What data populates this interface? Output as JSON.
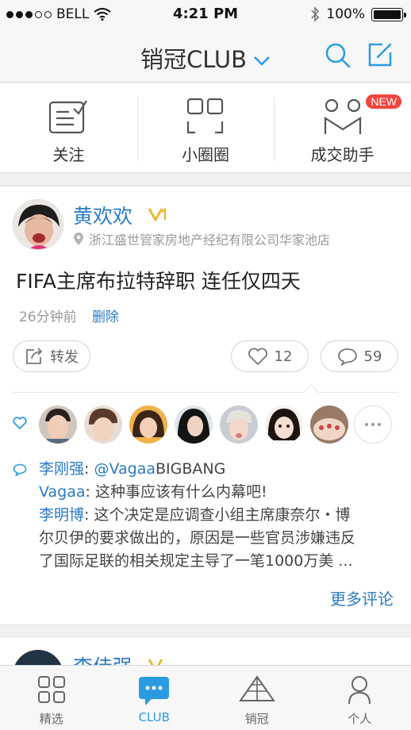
{
  "status_bar": {
    "carrier": "BELL",
    "time": "4:21 PM",
    "battery": "100%"
  },
  "nav": {
    "title": "销冠CLUB"
  },
  "quick_menu": [
    {
      "label": "关注"
    },
    {
      "label": "小圈圈"
    },
    {
      "label": "成交助手",
      "badge": "NEW"
    }
  ],
  "post": {
    "author": "黄欢欢",
    "verified_badge": "V",
    "location": "浙江盛世管家房地产经纪有限公司华家池店",
    "text": "FIFA主席布拉特辞职 连任仅四天",
    "time": "26分钟前",
    "delete_label": "删除",
    "forward_label": "转发",
    "like_count": "12",
    "comment_count": "59",
    "comments": [
      {
        "name": "李刚强",
        "sep": ": ",
        "mention": "@Vagaa",
        "text": "BIGBANG"
      },
      {
        "name": "Vagaa",
        "sep": ": ",
        "text": "这种事应该有什么内幕吧!"
      },
      {
        "name": "李明博",
        "sep": ": ",
        "text": "这个决定是应调查小组主席康奈尔・博"
      },
      {
        "text": "尔贝伊的要求做出的，原因是一些官员涉嫌违反"
      },
      {
        "text": "了国际足联的相关规定主导了一笔1000万美 ..."
      }
    ],
    "more_comments_label": "更多评论"
  },
  "next_post": {
    "author": "李佳强"
  },
  "tabs": [
    {
      "label": "精选",
      "icon": "grid-icon"
    },
    {
      "label": "CLUB",
      "icon": "chat-bubble-icon",
      "active": true
    },
    {
      "label": "销冠",
      "icon": "pyramid-icon"
    },
    {
      "label": "个人",
      "icon": "person-icon"
    }
  ],
  "colors": {
    "accent": "#2b9be0",
    "link": "#2b7bc4",
    "badge": "#f2453d",
    "gold": "#e8b93a"
  }
}
